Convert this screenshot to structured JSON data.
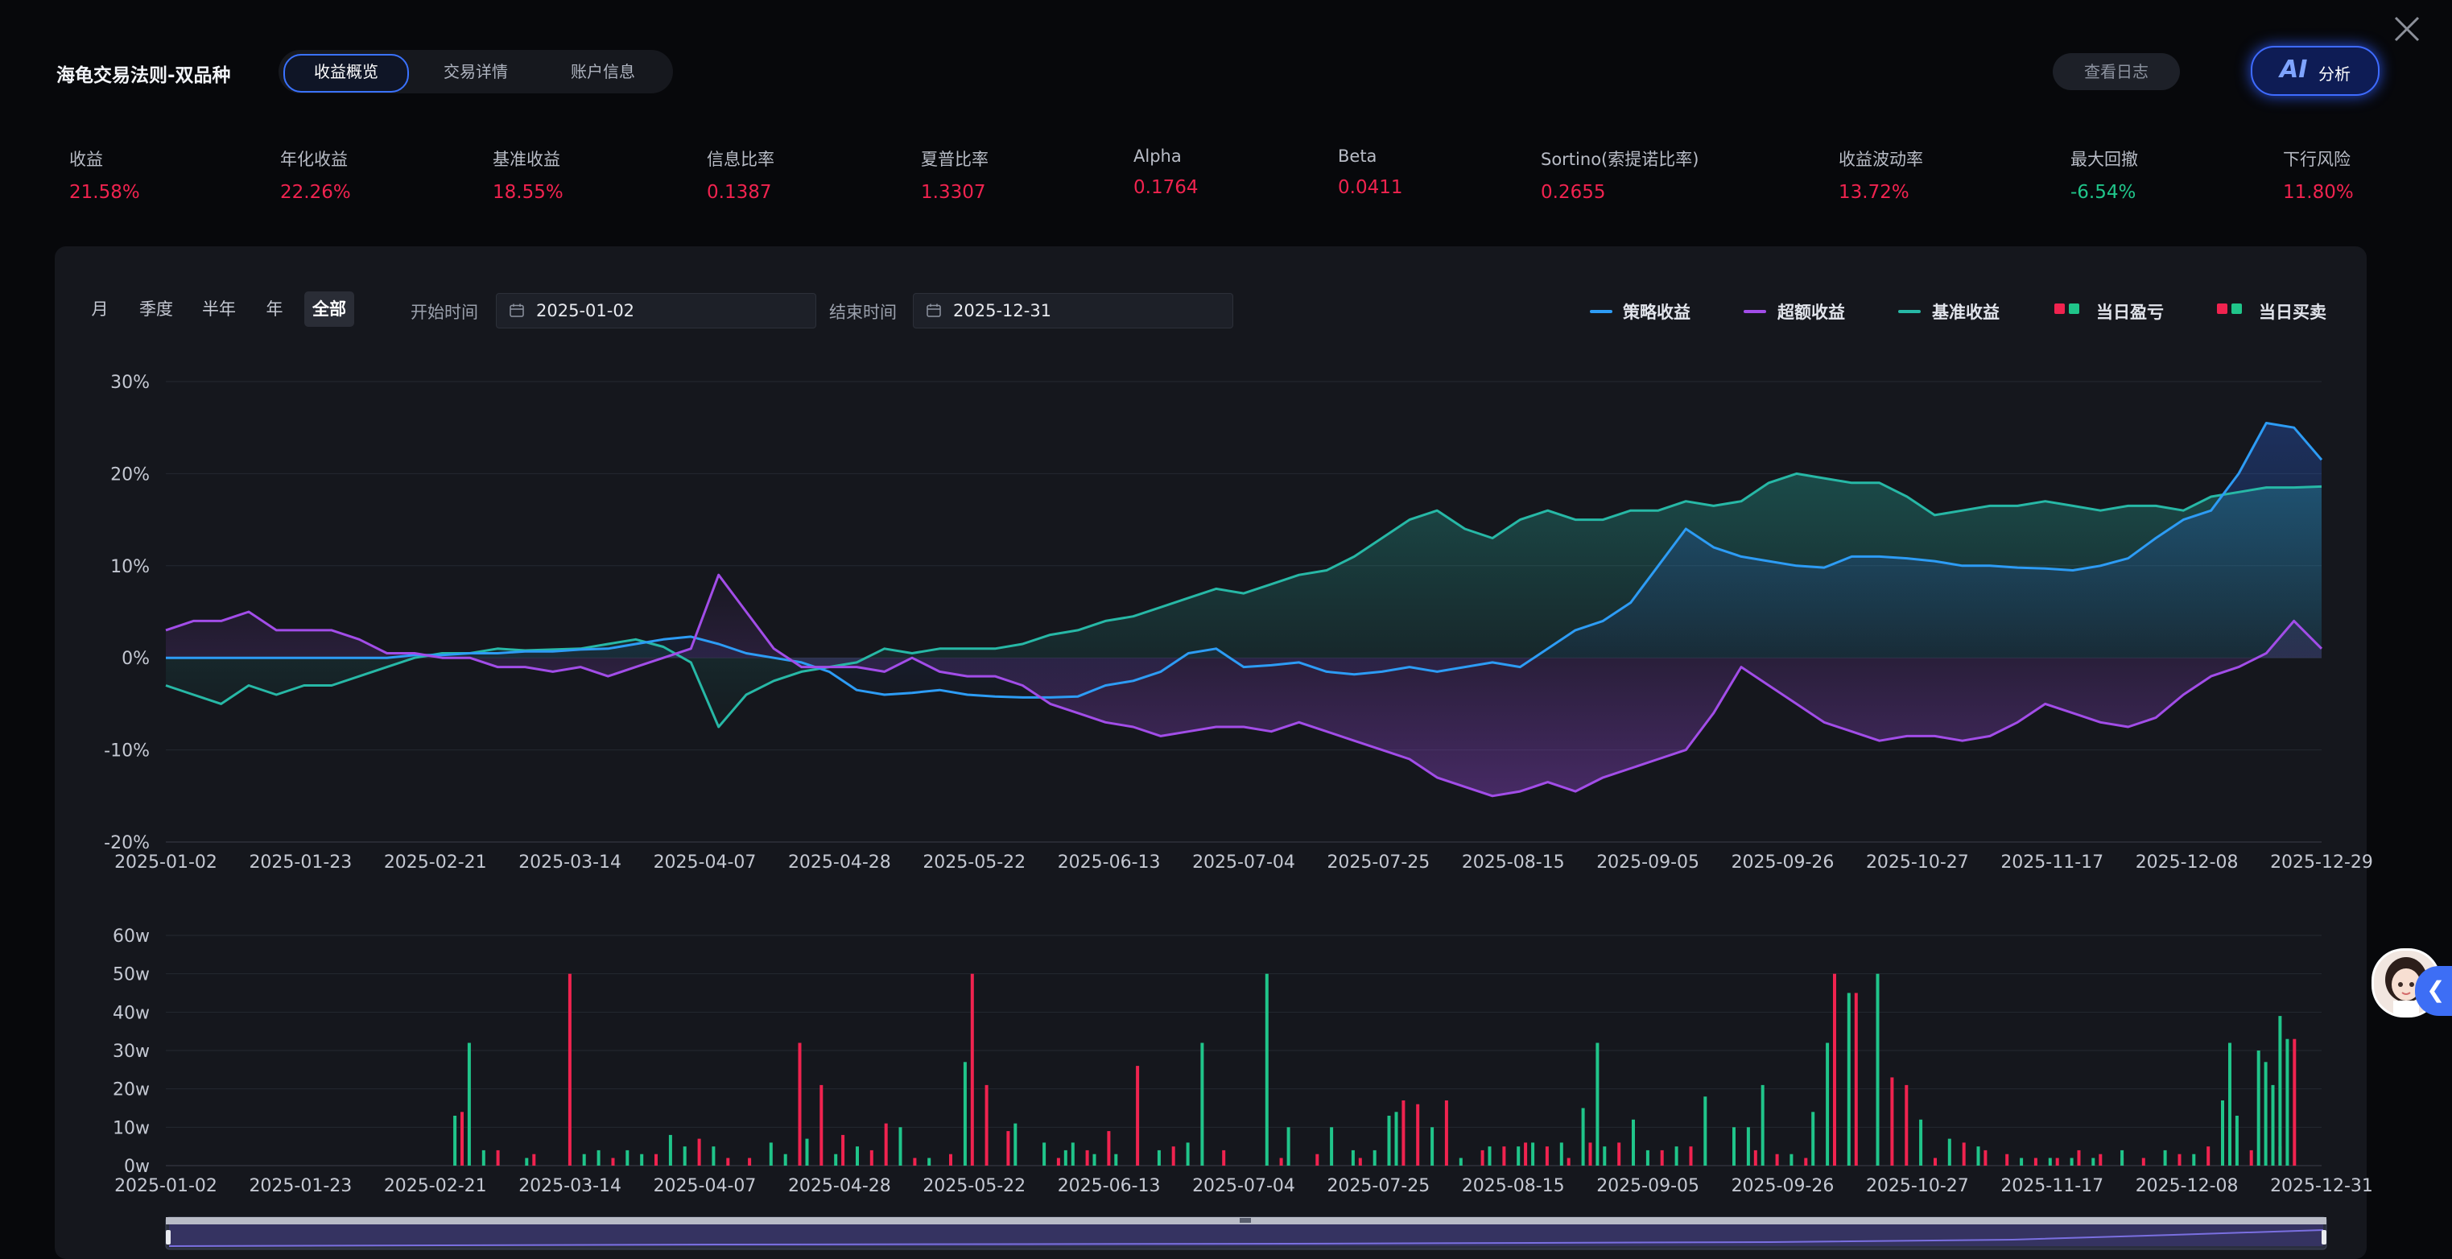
{
  "header": {
    "title": "海龟交易法则-双品种",
    "tabs": [
      {
        "label": "收益概览",
        "active": true
      },
      {
        "label": "交易详情",
        "active": false
      },
      {
        "label": "账户信息",
        "active": false
      }
    ],
    "log_button": "查看日志",
    "ai_button": {
      "mark": "AI",
      "label": "分析"
    }
  },
  "metrics": [
    {
      "label": "收益",
      "value": "21.58%",
      "tone": "up"
    },
    {
      "label": "年化收益",
      "value": "22.26%",
      "tone": "up"
    },
    {
      "label": "基准收益",
      "value": "18.55%",
      "tone": "up"
    },
    {
      "label": "信息比率",
      "value": "0.1387",
      "tone": "up"
    },
    {
      "label": "夏普比率",
      "value": "1.3307",
      "tone": "up"
    },
    {
      "label": "Alpha",
      "value": "0.1764",
      "tone": "up"
    },
    {
      "label": "Beta",
      "value": "0.0411",
      "tone": "up"
    },
    {
      "label": "Sortino(索提诺比率)",
      "value": "0.2655",
      "tone": "up"
    },
    {
      "label": "收益波动率",
      "value": "13.72%",
      "tone": "up"
    },
    {
      "label": "最大回撤",
      "value": "-6.54%",
      "tone": "down"
    },
    {
      "label": "下行风险",
      "value": "11.80%",
      "tone": "up"
    }
  ],
  "colors": {
    "up": "#f0234f",
    "down": "#20c58a",
    "strategy": "#2d9cf5",
    "excess": "#a24de8",
    "benchmark": "#27b8a6",
    "accent": "#3a72ff"
  },
  "controls": {
    "ranges": [
      {
        "label": "月",
        "active": false
      },
      {
        "label": "季度",
        "active": false
      },
      {
        "label": "半年",
        "active": false
      },
      {
        "label": "年",
        "active": false
      },
      {
        "label": "全部",
        "active": true
      }
    ],
    "start_label": "开始时间",
    "start_value": "2025-01-02",
    "end_label": "结束时间",
    "end_value": "2025-12-31"
  },
  "legend": [
    {
      "label": "策略收益",
      "kind": "line",
      "color": "#2d9cf5"
    },
    {
      "label": "超额收益",
      "kind": "line",
      "color": "#a24de8"
    },
    {
      "label": "基准收益",
      "kind": "line",
      "color": "#27b8a6"
    },
    {
      "label": "当日盈亏",
      "kind": "squares"
    },
    {
      "label": "当日买卖",
      "kind": "squares"
    }
  ],
  "chart_data": [
    {
      "type": "line",
      "y_ticks": [
        "30%",
        "20%",
        "10%",
        "0%",
        "-10%",
        "-20%"
      ],
      "ylim": [
        -20,
        30
      ],
      "x_ticks": [
        "2025-01-02",
        "2025-01-23",
        "2025-02-21",
        "2025-03-14",
        "2025-04-07",
        "2025-04-28",
        "2025-05-22",
        "2025-06-13",
        "2025-07-04",
        "2025-07-25",
        "2025-08-15",
        "2025-09-05",
        "2025-09-26",
        "2025-10-27",
        "2025-11-17",
        "2025-12-08",
        "2025-12-29"
      ],
      "grid": true,
      "series": [
        {
          "name": "策略收益",
          "color": "#2d9cf5",
          "values": [
            0,
            0,
            0,
            0,
            0,
            0,
            0,
            0,
            0,
            0.3,
            0.3,
            0.5,
            0.5,
            0.7,
            0.7,
            0.9,
            1.0,
            1.5,
            2.0,
            2.3,
            1.5,
            0.5,
            0,
            -0.5,
            -1.5,
            -3.5,
            -4.0,
            -3.8,
            -3.5,
            -4.0,
            -4.2,
            -4.3,
            -4.3,
            -4.2,
            -3.0,
            -2.5,
            -1.5,
            0.5,
            1.0,
            -1.0,
            -0.8,
            -0.5,
            -1.5,
            -1.8,
            -1.5,
            -1.0,
            -1.5,
            -1.0,
            -0.5,
            -1.0,
            1.0,
            3.0,
            4.0,
            6.0,
            10.0,
            14.0,
            12.0,
            11.0,
            10.5,
            10.0,
            9.8,
            11.0,
            11.0,
            10.8,
            10.5,
            10.0,
            10.0,
            9.8,
            9.7,
            9.5,
            10.0,
            10.8,
            13.0,
            15.0,
            16.0,
            20.0,
            25.5,
            25.0,
            21.5
          ]
        },
        {
          "name": "超额收益",
          "color": "#a24de8",
          "values": [
            3,
            4,
            4,
            5,
            3,
            3,
            3,
            2,
            0.5,
            0.5,
            0,
            0,
            -1,
            -1,
            -1.5,
            -1,
            -2,
            -1,
            0,
            1,
            9,
            5,
            1,
            -1,
            -1,
            -1,
            -1.5,
            0,
            -1.5,
            -2,
            -2,
            -3,
            -5,
            -6,
            -7,
            -7.5,
            -8.5,
            -8,
            -7.5,
            -7.5,
            -8,
            -7,
            -8,
            -9,
            -10,
            -11,
            -13,
            -14,
            -15,
            -14.5,
            -13.5,
            -14.5,
            -13,
            -12,
            -11,
            -10,
            -6,
            -1,
            -3,
            -5,
            -7,
            -8,
            -9,
            -8.5,
            -8.5,
            -9,
            -8.5,
            -7,
            -5,
            -6,
            -7,
            -7.5,
            -6.5,
            -4,
            -2,
            -1,
            0.5,
            4,
            1
          ]
        },
        {
          "name": "基准收益",
          "color": "#27b8a6",
          "values": [
            -3,
            -4,
            -5,
            -3,
            -4,
            -3,
            -3,
            -2,
            -1,
            0,
            0.5,
            0.5,
            1,
            0.8,
            0.9,
            1.0,
            1.5,
            2.0,
            1.2,
            -0.5,
            -7.5,
            -4,
            -2.5,
            -1.5,
            -1,
            -0.5,
            1,
            0.5,
            1.0,
            1.0,
            1.0,
            1.5,
            2.5,
            3.0,
            4.0,
            4.5,
            5.5,
            6.5,
            7.5,
            7.0,
            8.0,
            9.0,
            9.5,
            11.0,
            13.0,
            15.0,
            16.0,
            14.0,
            13.0,
            15.0,
            16.0,
            15.0,
            15.0,
            16.0,
            16.0,
            17.0,
            16.5,
            17.0,
            19.0,
            20.0,
            19.5,
            19.0,
            19.0,
            17.5,
            15.5,
            16.0,
            16.5,
            16.5,
            17.0,
            16.5,
            16.0,
            16.5,
            16.5,
            16.0,
            17.5,
            18.0,
            18.5,
            18.5,
            18.6
          ]
        }
      ]
    },
    {
      "type": "bar",
      "y_ticks": [
        "60w",
        "50w",
        "40w",
        "30w",
        "20w",
        "10w",
        "0w"
      ],
      "ylim": [
        0,
        60
      ],
      "x_ticks": [
        "2025-01-02",
        "2025-01-23",
        "2025-02-21",
        "2025-03-14",
        "2025-04-07",
        "2025-04-28",
        "2025-05-22",
        "2025-06-13",
        "2025-07-04",
        "2025-07-25",
        "2025-08-15",
        "2025-09-05",
        "2025-09-26",
        "2025-10-27",
        "2025-11-17",
        "2025-12-08",
        "2025-12-31"
      ],
      "grid": true,
      "series": [
        {
          "name": "当日买卖(买入)",
          "color": "#f0234f",
          "bars": [
            [
              0.205,
              14
            ],
            [
              0.23,
              4
            ],
            [
              0.255,
              3
            ],
            [
              0.28,
              50
            ],
            [
              0.31,
              2
            ],
            [
              0.34,
              3
            ],
            [
              0.37,
              7
            ],
            [
              0.39,
              2
            ],
            [
              0.405,
              2
            ],
            [
              0.44,
              32
            ],
            [
              0.455,
              21
            ],
            [
              0.47,
              8
            ],
            [
              0.49,
              4
            ],
            [
              0.5,
              11
            ],
            [
              0.52,
              2
            ],
            [
              0.545,
              3
            ],
            [
              0.56,
              50
            ],
            [
              0.57,
              21
            ],
            [
              0.585,
              9
            ],
            [
              0.62,
              2
            ],
            [
              0.64,
              4
            ],
            [
              0.655,
              9
            ],
            [
              0.675,
              26
            ],
            [
              0.7,
              5
            ],
            [
              0.735,
              4
            ],
            [
              0.775,
              2
            ],
            [
              0.8,
              3
            ],
            [
              0.83,
              2
            ],
            [
              0.86,
              17
            ],
            [
              0.87,
              16
            ],
            [
              0.89,
              17
            ],
            [
              0.915,
              4
            ],
            [
              0.93,
              5
            ],
            [
              0.945,
              6
            ],
            [
              0.96,
              5
            ],
            [
              0.975,
              2
            ],
            [
              0.99,
              6
            ],
            [
              1.01,
              6
            ],
            [
              1.04,
              4
            ],
            [
              1.06,
              5
            ],
            [
              1.105,
              4
            ],
            [
              1.12,
              3
            ],
            [
              1.14,
              2
            ],
            [
              1.16,
              50
            ],
            [
              1.175,
              45
            ],
            [
              1.2,
              23
            ],
            [
              1.21,
              21
            ],
            [
              1.23,
              2
            ],
            [
              1.25,
              6
            ],
            [
              1.265,
              4
            ],
            [
              1.28,
              3
            ],
            [
              1.3,
              2
            ],
            [
              1.315,
              2
            ],
            [
              1.33,
              4
            ],
            [
              1.345,
              3
            ],
            [
              1.36,
              2
            ],
            [
              1.375,
              2
            ],
            [
              1.4,
              3
            ],
            [
              1.42,
              5
            ],
            [
              1.45,
              4
            ],
            [
              1.47,
              5
            ],
            [
              1.48,
              33
            ]
          ]
        },
        {
          "name": "当日买卖(卖出)",
          "color": "#20c58a",
          "bars": [
            [
              0.2,
              13
            ],
            [
              0.21,
              32
            ],
            [
              0.22,
              4
            ],
            [
              0.25,
              2
            ],
            [
              0.29,
              3
            ],
            [
              0.3,
              4
            ],
            [
              0.32,
              4
            ],
            [
              0.33,
              3
            ],
            [
              0.35,
              8
            ],
            [
              0.36,
              5
            ],
            [
              0.38,
              5
            ],
            [
              0.42,
              6
            ],
            [
              0.43,
              3
            ],
            [
              0.445,
              7
            ],
            [
              0.465,
              3
            ],
            [
              0.48,
              5
            ],
            [
              0.51,
              10
            ],
            [
              0.53,
              2
            ],
            [
              0.555,
              27
            ],
            [
              0.59,
              11
            ],
            [
              0.61,
              6
            ],
            [
              0.625,
              4
            ],
            [
              0.63,
              6
            ],
            [
              0.645,
              3
            ],
            [
              0.66,
              3
            ],
            [
              0.69,
              4
            ],
            [
              0.71,
              6
            ],
            [
              0.72,
              32
            ],
            [
              0.765,
              50
            ],
            [
              0.78,
              10
            ],
            [
              0.81,
              10
            ],
            [
              0.825,
              4
            ],
            [
              0.84,
              4
            ],
            [
              0.85,
              13
            ],
            [
              0.855,
              14
            ],
            [
              0.88,
              10
            ],
            [
              0.9,
              2
            ],
            [
              0.92,
              5
            ],
            [
              0.94,
              5
            ],
            [
              0.95,
              6
            ],
            [
              0.97,
              6
            ],
            [
              0.985,
              15
            ],
            [
              0.995,
              32
            ],
            [
              1.0,
              5
            ],
            [
              1.02,
              12
            ],
            [
              1.03,
              4
            ],
            [
              1.05,
              5
            ],
            [
              1.07,
              18
            ],
            [
              1.09,
              10
            ],
            [
              1.1,
              10
            ],
            [
              1.11,
              21
            ],
            [
              1.13,
              3
            ],
            [
              1.145,
              14
            ],
            [
              1.155,
              32
            ],
            [
              1.17,
              45
            ],
            [
              1.19,
              50
            ],
            [
              1.22,
              12
            ],
            [
              1.24,
              7
            ],
            [
              1.26,
              5
            ],
            [
              1.29,
              2
            ],
            [
              1.31,
              2
            ],
            [
              1.325,
              2
            ],
            [
              1.34,
              2
            ],
            [
              1.36,
              4
            ],
            [
              1.39,
              4
            ],
            [
              1.41,
              3
            ],
            [
              1.43,
              17
            ],
            [
              1.435,
              32
            ],
            [
              1.44,
              13
            ],
            [
              1.455,
              30
            ],
            [
              1.46,
              27
            ],
            [
              1.465,
              21
            ],
            [
              1.47,
              39
            ],
            [
              1.475,
              33
            ]
          ]
        }
      ]
    }
  ]
}
